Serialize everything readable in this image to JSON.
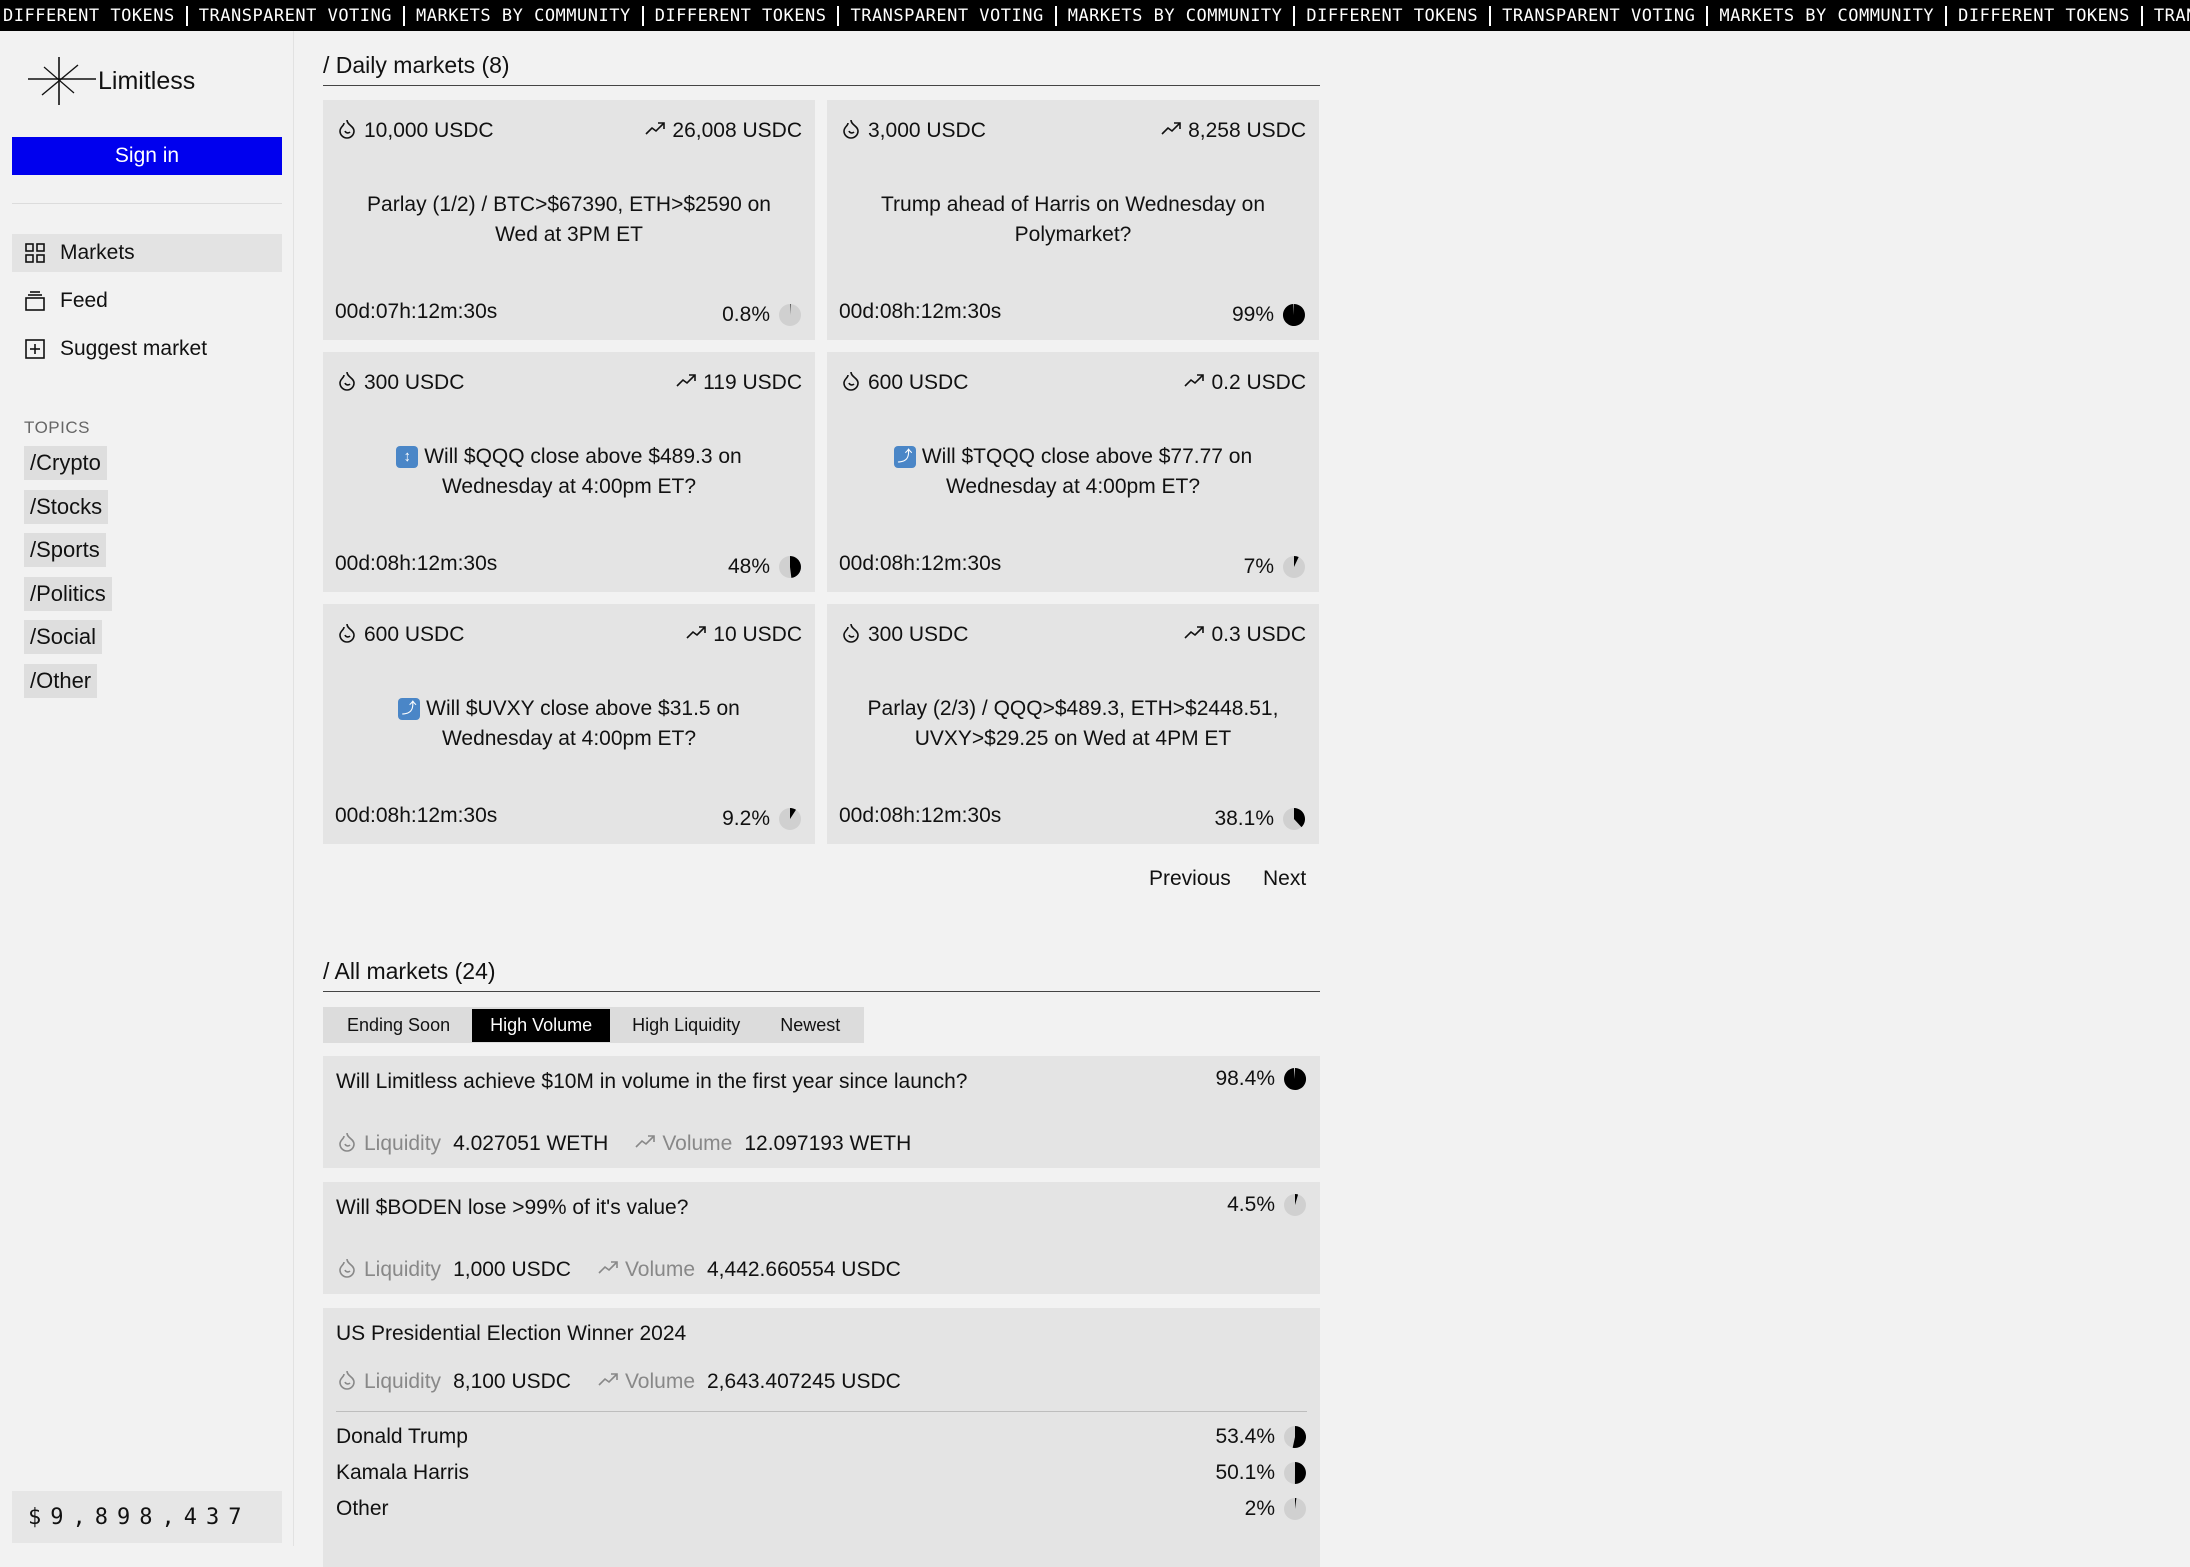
{
  "ticker": [
    "DIFFERENT TOKENS",
    "TRANSPARENT VOTING",
    "MARKETS BY COMMUNITY",
    "DIFFERENT TOKENS",
    "TRANSPARENT VOTING",
    "MARKETS BY COMMUNITY",
    "DIFFERENT TOKENS",
    "TRANSPARENT VOTING",
    "MARKETS BY COMMUNITY",
    "DIFFERENT TOKENS",
    "TRANSPARENT VOTING"
  ],
  "brand": "Limitless",
  "signin_label": "Sign in",
  "nav": [
    {
      "label": "Markets",
      "icon": "grid-icon",
      "active": true
    },
    {
      "label": "Feed",
      "icon": "stack-icon",
      "active": false
    },
    {
      "label": "Suggest market",
      "icon": "plus-square-icon",
      "active": false
    }
  ],
  "topics_heading": "TOPICS",
  "topics": [
    "/Crypto",
    "/Stocks",
    "/Sports",
    "/Politics",
    "/Social",
    "/Other"
  ],
  "balance": "$9,898,437",
  "daily": {
    "heading": "/ Daily markets (8)",
    "cards": [
      {
        "liquidity": "10,000 USDC",
        "volume": "26,008 USDC",
        "title": "Parlay (1/2) / BTC>$67390, ETH>$2590 on Wed at 3PM ET",
        "emoji": "",
        "timer": "00d:07h:12m:30s",
        "pct_label": "0.8%",
        "pct": 0.8
      },
      {
        "liquidity": "3,000 USDC",
        "volume": "8,258 USDC",
        "title": "Trump ahead of Harris on Wednesday on Polymarket?",
        "emoji": "",
        "timer": "00d:08h:12m:30s",
        "pct_label": "99%",
        "pct": 99
      },
      {
        "liquidity": "300 USDC",
        "volume": "119 USDC",
        "title": "Will $QQQ close above $489.3 on Wednesday at 4:00pm ET?",
        "emoji": "↕",
        "timer": "00d:08h:12m:30s",
        "pct_label": "48%",
        "pct": 48
      },
      {
        "liquidity": "600 USDC",
        "volume": "0.2 USDC",
        "title": "Will $TQQQ close above $77.77 on Wednesday at 4:00pm ET?",
        "emoji": "⤴",
        "timer": "00d:08h:12m:30s",
        "pct_label": "7%",
        "pct": 7
      },
      {
        "liquidity": "600 USDC",
        "volume": "10 USDC",
        "title": "Will $UVXY close above $31.5 on Wednesday at 4:00pm ET?",
        "emoji": "⤴",
        "timer": "00d:08h:12m:30s",
        "pct_label": "9.2%",
        "pct": 9.2
      },
      {
        "liquidity": "300 USDC",
        "volume": "0.3 USDC",
        "title": "Parlay (2/3) / QQQ>$489.3, ETH>$2448.51, UVXY>$29.25 on Wed at 4PM ET",
        "emoji": "",
        "timer": "00d:08h:12m:30s",
        "pct_label": "38.1%",
        "pct": 38.1
      }
    ],
    "previous_label": "Previous",
    "next_label": "Next"
  },
  "all": {
    "heading": "/ All markets (24)",
    "filters": [
      {
        "label": "Ending Soon",
        "active": false
      },
      {
        "label": "High Volume",
        "active": true
      },
      {
        "label": "High Liquidity",
        "active": false
      },
      {
        "label": "Newest",
        "active": false
      }
    ],
    "liquidity_label": "Liquidity",
    "volume_label": "Volume",
    "markets": [
      {
        "question": "Will Limitless achieve $10M in volume in the first year since launch?",
        "pct_label": "98.4%",
        "pct": 98.4,
        "liquidity": "4.027051 WETH",
        "volume": "12.097193 WETH"
      },
      {
        "question": "Will $BODEN lose >99% of it's value?",
        "pct_label": "4.5%",
        "pct": 4.5,
        "liquidity": "1,000 USDC",
        "volume": "4,442.660554 USDC"
      },
      {
        "question": "US Presidential Election Winner 2024",
        "liquidity": "8,100 USDC",
        "volume": "2,643.407245 USDC",
        "options": [
          {
            "name": "Donald Trump",
            "pct_label": "53.4%",
            "pct": 53.4
          },
          {
            "name": "Kamala Harris",
            "pct_label": "50.1%",
            "pct": 50.1
          },
          {
            "name": "Other",
            "pct_label": "2%",
            "pct": 2
          }
        ]
      }
    ]
  }
}
